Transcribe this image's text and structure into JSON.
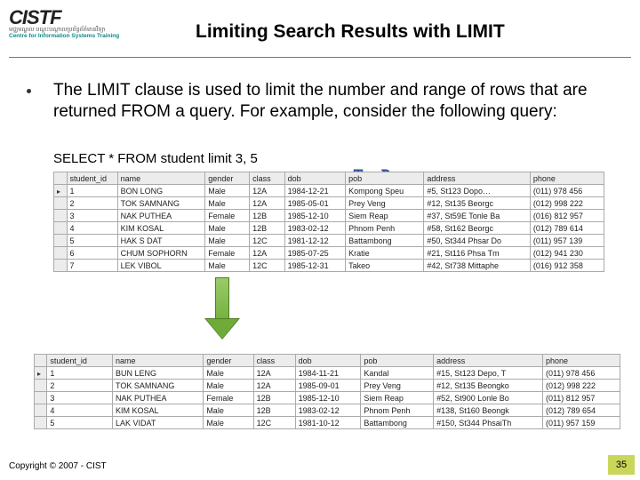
{
  "logo": {
    "mark": "CISTF",
    "sub_left": "មជ្ឈមណ្ឌល",
    "sub_teal": "Centre for",
    "sub_right": "បណ្តុះបណ្តាលប្រព័ន្ធព័ត៌មានវិទ្យា",
    "sub_right_teal": "Information Systems Training"
  },
  "title": "Limiting Search Results with LIMIT",
  "body": "The LIMIT clause is used to limit the number and range of rows that are returned FROM a query. For example, consider the following query:",
  "sql": "SELECT * FROM student limit 3, 5",
  "todo": "To Do",
  "table1": {
    "headers": [
      "student_id",
      "name",
      "gender",
      "class",
      "dob",
      "pob",
      "address",
      "phone"
    ],
    "rows": [
      [
        "1",
        "BON LONG",
        "Male",
        "12A",
        "1984-12-21",
        "Kompong Speu",
        "#5, St123 Dopo…",
        "(011) 978 456"
      ],
      [
        "2",
        "TOK SAMNANG",
        "Male",
        "12A",
        "1985-05-01",
        "Prey Veng",
        "#12, St135 Beorgc",
        "(012) 998 222"
      ],
      [
        "3",
        "NAK PUTHEA",
        "Female",
        "12B",
        "1985-12-10",
        "Siem Reap",
        "#37, St59E Tonle Ba",
        "(016) 812 957"
      ],
      [
        "4",
        "KIM KOSAL",
        "Male",
        "12B",
        "1983-02-12",
        "Phnom Penh",
        "#58, St162 Beorgc",
        "(012) 789 614"
      ],
      [
        "5",
        "HAK S DAT",
        "Male",
        "12C",
        "1981-12-12",
        "Battambong",
        "#50, St344 Phsar Do",
        "(011) 957 139"
      ],
      [
        "6",
        "CHUM SOPHORN",
        "Female",
        "12A",
        "1985-07-25",
        "Kratie",
        "#21, St116 Phsa Tm",
        "(012) 941 230"
      ],
      [
        "7",
        "LEK VIBOL",
        "Male",
        "12C",
        "1985-12-31",
        "Takeo",
        "#42, St738 Mittaphe",
        "(016) 912 358"
      ]
    ]
  },
  "table2": {
    "headers": [
      "student_id",
      "name",
      "gender",
      "class",
      "dob",
      "pob",
      "address",
      "phone"
    ],
    "rows": [
      [
        "1",
        "BUN LENG",
        "Male",
        "12A",
        "1984-11-21",
        "Kandal",
        "#15, St123 Depo, T",
        "(011) 978 456"
      ],
      [
        "2",
        "TOK SAMNANG",
        "Male",
        "12A",
        "1985-09-01",
        "Prey Veng",
        "#12, St135 Beongko",
        "(012) 998 222"
      ],
      [
        "3",
        "NAK PUTHEA",
        "Female",
        "12B",
        "1985-12-10",
        "Siem Reap",
        "#52, St900 Lonle Bo",
        "(011) 812 957"
      ],
      [
        "4",
        "KIM KOSAL",
        "Male",
        "12B",
        "1983-02-12",
        "Phnom Penh",
        "#138, St160 Beongk",
        "(012) 789 654"
      ],
      [
        "5",
        "LAK VIDAT",
        "Male",
        "12C",
        "1981-10-12",
        "Battambong",
        "#150, St344 PhsaiTh",
        "(011) 957 159"
      ]
    ]
  },
  "footer": {
    "copyright": "Copyright © 2007 - CIST",
    "page": "35"
  }
}
